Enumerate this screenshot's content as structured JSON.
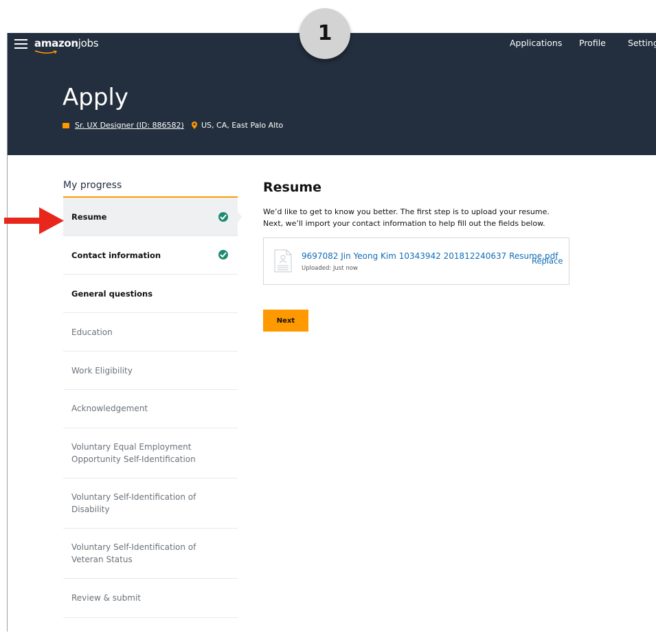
{
  "step_badge": "1",
  "topbar": {
    "logo_bold": "amazon",
    "logo_light": "jobs",
    "nav": [
      "Applications",
      "Profile",
      "Settings"
    ]
  },
  "hero": {
    "title": "Apply",
    "job_link": "Sr. UX Designer (ID: 886582)",
    "location": "US, CA, East Palo Alto"
  },
  "progress": {
    "heading": "My progress",
    "steps": [
      {
        "label": "Resume",
        "state": "current"
      },
      {
        "label": "Contact information",
        "state": "done"
      },
      {
        "label": "General questions",
        "state": "available"
      },
      {
        "label": "Education",
        "state": "todo"
      },
      {
        "label": "Work Eligibility",
        "state": "todo"
      },
      {
        "label": "Acknowledgement",
        "state": "todo"
      },
      {
        "label": "Voluntary Equal Employment Opportunity Self-Identification",
        "state": "todo"
      },
      {
        "label": "Voluntary Self-Identification of Disability",
        "state": "todo"
      },
      {
        "label": "Voluntary Self-Identification of Veteran Status",
        "state": "todo"
      },
      {
        "label": "Review & submit",
        "state": "todo"
      }
    ]
  },
  "main": {
    "title": "Resume",
    "description": "We’d like to get to know you better. The first step is to upload your resume. Next, we’ll import your contact information to help fill out the fields below.",
    "file": {
      "name": "9697082 Jin Yeong Kim 10343942 201812240637 Resume.pdf",
      "status": "Uploaded: Just now",
      "replace_label": "Replace"
    },
    "next_label": "Next"
  },
  "colors": {
    "navy": "#232f3e",
    "orange": "#ff9900",
    "check_green": "#1f8a72",
    "link_blue": "#0f6cb6",
    "annotation_red": "#e8261c"
  }
}
